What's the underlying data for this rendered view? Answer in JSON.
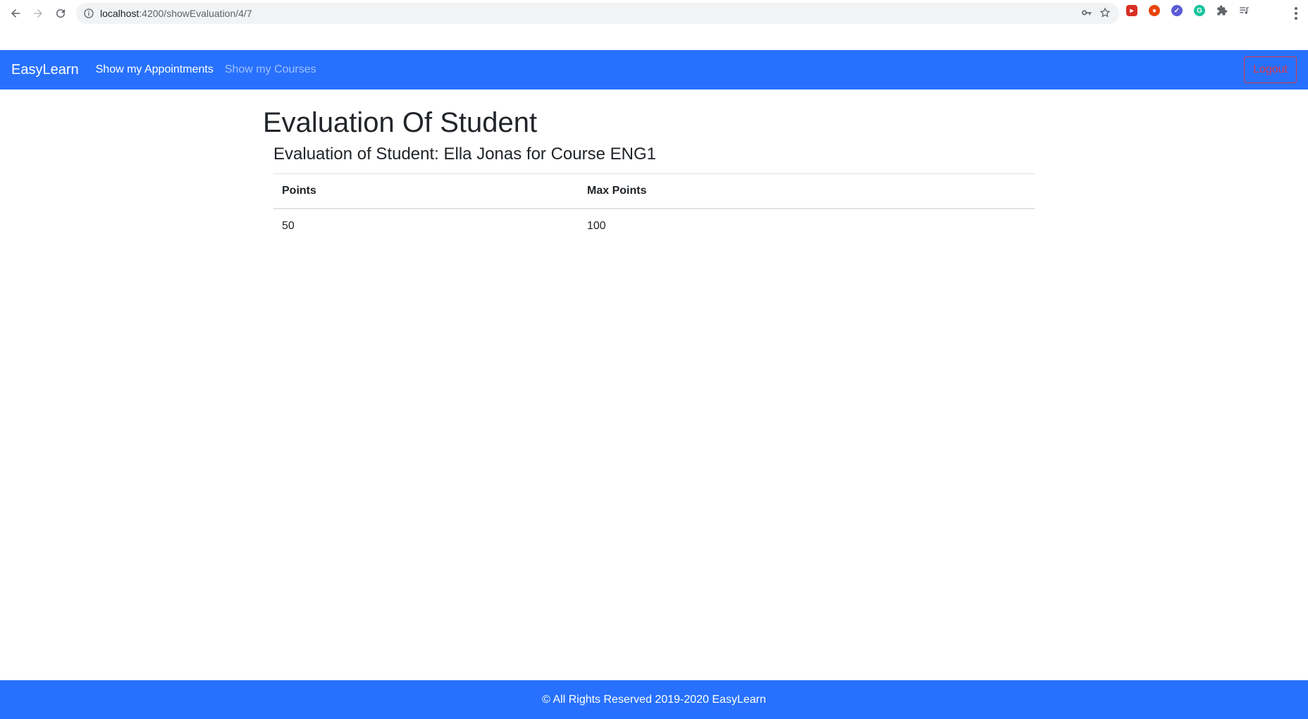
{
  "browser": {
    "url_host": "localhost",
    "url_path": ":4200/showEvaluation/4/7",
    "icons": [
      "back-icon",
      "forward-icon",
      "reload-icon",
      "info-icon",
      "key-icon",
      "star-icon",
      "puzzle-icon",
      "playlist-icon",
      "kebab-menu-icon"
    ]
  },
  "navbar": {
    "brand": "EasyLearn",
    "links": [
      {
        "label": "Show my Appointments"
      },
      {
        "label": "Show my Courses"
      }
    ],
    "logout_label": "Logout",
    "bg_color": "#2871fe",
    "logout_color": "#dc3545"
  },
  "main": {
    "page_title": "Evaluation Of Student",
    "card_title": "Evaluation of Student: Ella Jonas for Course ENG1",
    "table": {
      "headers": [
        "Points",
        "Max Points"
      ],
      "rows": [
        [
          "50",
          "100"
        ]
      ]
    }
  },
  "footer": {
    "text": "© All Rights Reserved 2019-2020 EasyLearn"
  }
}
